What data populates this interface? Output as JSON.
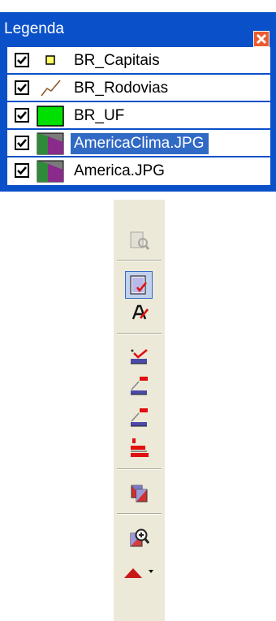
{
  "legend": {
    "title": "Legenda",
    "colors": {
      "title_bar": "#0a50c8",
      "selection": "#316ac5",
      "close": "#ec5a2e"
    },
    "layers": [
      {
        "label": "BR_Capitais",
        "checked": true,
        "symbol": "point-symbol-icon"
      },
      {
        "label": "BR_Rodovias",
        "checked": true,
        "symbol": "line-symbol-icon"
      },
      {
        "label": "BR_UF",
        "checked": true,
        "symbol": "polygon-symbol-icon"
      },
      {
        "label": "AmericaClima.JPG",
        "checked": true,
        "symbol": "raster-symbol-icon",
        "selected": true
      },
      {
        "label": "America.JPG",
        "checked": true,
        "symbol": "raster-symbol-icon"
      }
    ]
  },
  "toolbar": {
    "tools": [
      "zoom-layer-icon",
      "select-layer-icon",
      "edit-label-icon",
      "edit-point-icon",
      "edit-line-icon",
      "edit-line-2-icon",
      "edit-polygon-icon",
      "copy-layer-icon",
      "zoom-in-icon",
      "triangle-menu-icon"
    ]
  }
}
